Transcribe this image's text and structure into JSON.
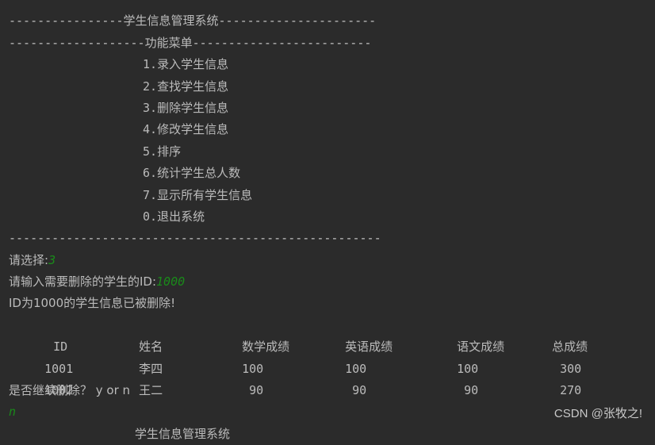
{
  "console": {
    "header_line": {
      "dashes_left": "----------------",
      "title": "学生信息管理系统",
      "dashes_right": "----------------------"
    },
    "menu_header_line": {
      "dashes_left": "-------------------",
      "title": "功能菜单",
      "dashes_right": "-------------------------"
    },
    "menu_items": [
      {
        "num": "1.",
        "label": "录入学生信息"
      },
      {
        "num": "2.",
        "label": "查找学生信息"
      },
      {
        "num": "3.",
        "label": "删除学生信息"
      },
      {
        "num": "4.",
        "label": "修改学生信息"
      },
      {
        "num": "5.",
        "label": "排序"
      },
      {
        "num": "6.",
        "label": "统计学生总人数"
      },
      {
        "num": "7.",
        "label": "显示所有学生信息"
      },
      {
        "num": "0.",
        "label": "退出系统"
      }
    ],
    "separator": "----------------------------------------------------",
    "prompt_choice": {
      "label": "请选择:",
      "input": "3"
    },
    "prompt_id": {
      "label": "请输入需要删除的学生的ID:",
      "input": "1000"
    },
    "deleted_msg": "ID为1000的学生信息已被删除!",
    "table": {
      "headers": [
        "ID",
        "姓名",
        "数学成绩",
        "英语成绩",
        "语文成绩",
        "总成绩"
      ],
      "rows": [
        [
          "1001",
          "李四",
          "100",
          "100",
          "100",
          "300"
        ],
        [
          "1002",
          "王二",
          " 90",
          " 90",
          " 90",
          "270"
        ]
      ]
    },
    "continue_prompt": "是否继续删除？ y or n",
    "continue_input": "n",
    "next_header_partial": "学生信息管理系统"
  },
  "watermark": "CSDN @张牧之!"
}
